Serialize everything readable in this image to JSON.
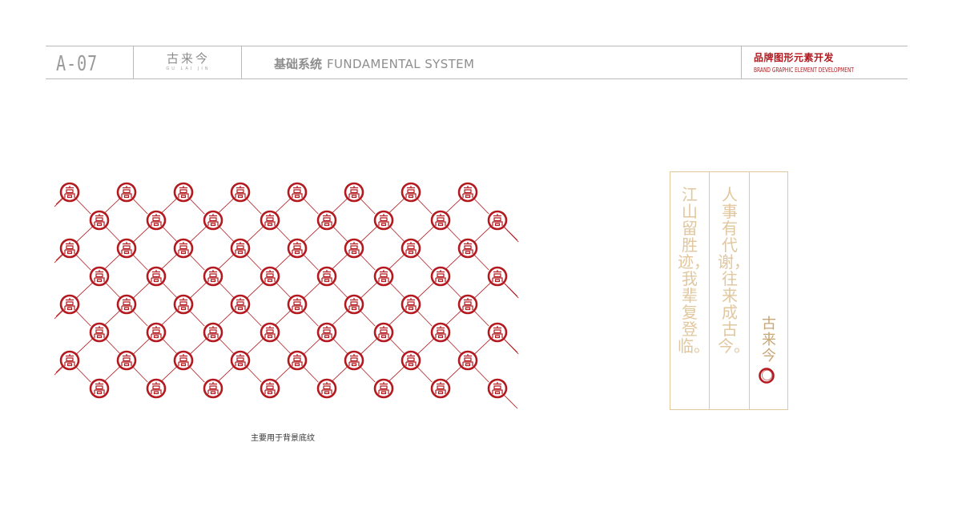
{
  "header": {
    "page_code": "A-07",
    "logo_text": "古来今",
    "logo_sub": "GU LAI JIN",
    "section_cn": "基础系统",
    "section_en": "FUNDAMENTAL SYSTEM",
    "brand_title_cn": "品牌图形元素开发",
    "brand_title_en": "BRAND GRAPHIC ELEMENT DEVELOPMENT"
  },
  "pattern": {
    "rows": 8,
    "cols": 8,
    "emblem_color": "#b3191e"
  },
  "caption": "主要用于背景底纹",
  "poem_panel": {
    "line1": "江山留胜迹，我辈复登临。",
    "line2": "人事有代谢，往来成古今。",
    "signature": "古来今",
    "text_color": "#e2c79e",
    "border_color": "#e3c79d"
  },
  "colors": {
    "brand_red": "#b3191e",
    "rule_gray": "#b9b9b9"
  }
}
